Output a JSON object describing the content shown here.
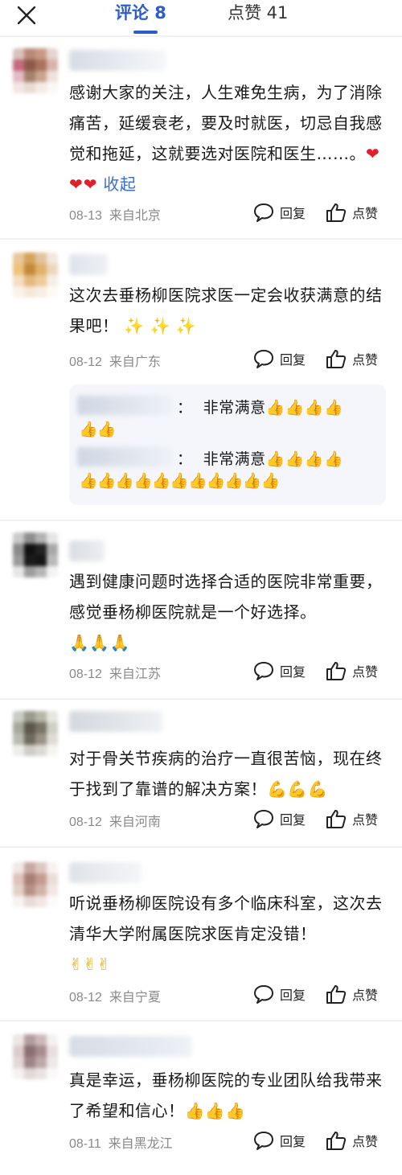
{
  "header": {
    "close_icon": "close-icon",
    "tabs": [
      {
        "label": "评论 8",
        "active": true
      },
      {
        "label": "点赞 41",
        "active": false
      }
    ],
    "accent_color": "#2b5ec8"
  },
  "actions": {
    "reply_label": "回复",
    "like_label": "点赞"
  },
  "comments": [
    {
      "text": "感谢大家的关注，人生难免生病，为了消除痛苦，延缓衰老，要及时就医，切忌自我感觉和拖延，这就要选对医院和医生……。",
      "hearts": "❤❤❤",
      "collapse_label": "收起",
      "date": "08-13",
      "location": "来自北京"
    },
    {
      "text": "这次去垂杨柳医院求医一定会收获满意的结果吧！",
      "emoji": "✨ ✨ ✨",
      "date": "08-12",
      "location": "来自广东",
      "replies": [
        {
          "separator": "：",
          "text": "非常满意👍👍👍👍",
          "emoji_line": "👍👍"
        },
        {
          "separator": "：",
          "text": "非常满意👍👍👍👍",
          "emoji_line": "👍👍👍👍👍👍👍👍👍👍👍"
        }
      ]
    },
    {
      "text": "遇到健康问题时选择合适的医院非常重要，感觉垂杨柳医院就是一个好选择。",
      "emoji": "🙏🙏🙏",
      "date": "08-12",
      "location": "来自江苏"
    },
    {
      "text": "对于骨关节疾病的治疗一直很苦恼，现在终于找到了靠谱的解决方案！💪💪💪",
      "date": "08-12",
      "location": "来自河南"
    },
    {
      "text": "听说垂杨柳医院设有多个临床科室，这次去清华大学附属医院求医肯定没错！",
      "emoji": "✌✌✌",
      "date": "08-12",
      "location": "来自宁夏"
    },
    {
      "text": "真是幸运，垂杨柳医院的专业团队给我带来了希望和信心！👍👍👍",
      "date": "08-11",
      "location": "来自黑龙江"
    }
  ]
}
